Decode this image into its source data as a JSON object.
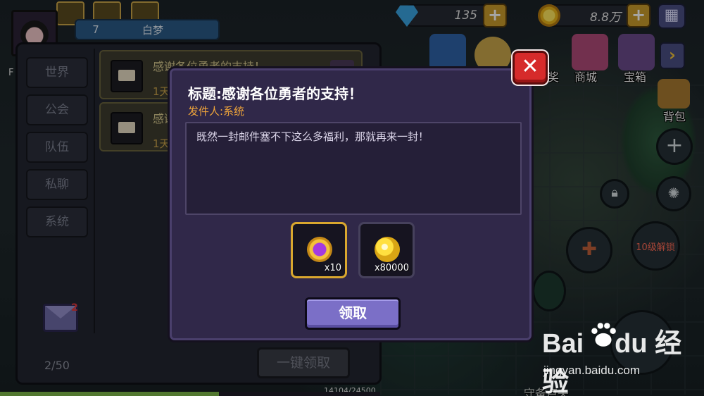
{
  "player": {
    "level": "7",
    "name": "白梦",
    "tag": "F"
  },
  "currency": {
    "gems": "135",
    "gold": "8.8万"
  },
  "top_menu": {
    "item2_label": "奖",
    "shop_label": "商城",
    "treasure_label": "宝箱",
    "bag_label": "背包"
  },
  "side_buttons": {
    "lock_label": "10级解锁"
  },
  "bottom": {
    "exp_text": "14104/24500",
    "exp_fraction": 0.576,
    "character_text": "守备卢夫"
  },
  "mailbox": {
    "tabs": [
      "世界",
      "公会",
      "队伍",
      "私聊",
      "系统"
    ],
    "items": [
      {
        "title": "感谢各位勇者的支持！",
        "time": "1天"
      },
      {
        "title": "感谢",
        "time": "1天"
      }
    ],
    "unread_badge": "2",
    "page_count": "2/50",
    "claim_all_label": "一键领取"
  },
  "dialog": {
    "title": "标题:感谢各位勇者的支持！",
    "sender": "发件人:系统",
    "body": "既然一封邮件塞不下这么多福利，那就再来一封！",
    "rewards": [
      {
        "icon": "purple-coin-icon",
        "qty": "x10"
      },
      {
        "icon": "gold-coin-icon",
        "qty": "x80000"
      }
    ],
    "claim_label": "领取",
    "close_icon": "close-icon"
  },
  "watermark": {
    "logo": "Bai du 经验",
    "url": "jingyan.baidu.com"
  },
  "colors": {
    "accent_purple": "#7b6fc7",
    "close_red": "#d62b2b",
    "sender_orange": "#f0a53a",
    "selected_gold": "#d9a72e"
  }
}
